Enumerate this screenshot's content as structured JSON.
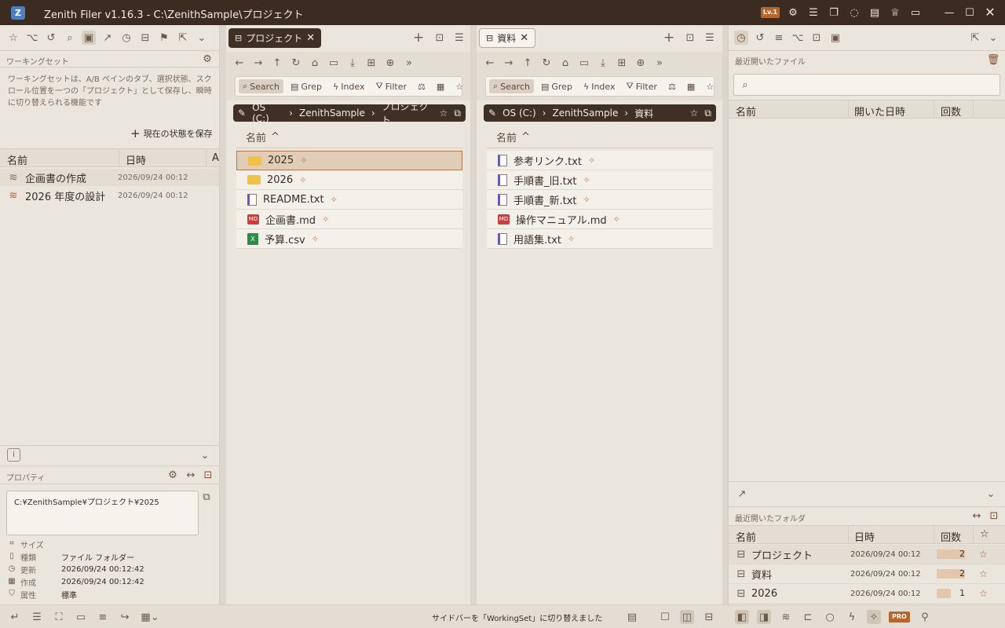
{
  "titlebar": {
    "app_title": "Zenith Filer v1.16.3 - C:\\ZenithSample\\プロジェクト",
    "level_badge": "Lv.1",
    "logo": "Z"
  },
  "left": {
    "workingset_label": "ワーキングセット",
    "workingset_desc": "ワーキングセットは、A/B ペインのタブ、選択状態、スクロール位置を一つの「プロジェクト」として保存し、瞬時に切り替えられる機能です",
    "save_button": "現在の状態を保存",
    "columns": {
      "name": "名前",
      "date": "日時",
      "extra": "A"
    },
    "items": [
      {
        "name": "企画書の作成",
        "date": "2026/09/24 00:12"
      },
      {
        "name": "2026 年度の設計",
        "date": "2026/09/24 00:12"
      }
    ],
    "properties_label": "プロパティ",
    "path_value": "C:¥ZenithSample¥プロジェクト¥2025",
    "props": [
      {
        "label": "サイズ",
        "value": ""
      },
      {
        "label": "種類",
        "value": "ファイル フォルダー"
      },
      {
        "label": "更新",
        "value": "2026/09/24 00:12:42"
      },
      {
        "label": "作成",
        "value": "2026/09/24 00:12:42"
      },
      {
        "label": "属性",
        "value": "標準"
      }
    ]
  },
  "paneA": {
    "tab_label": "プロジェクト",
    "search": {
      "search": "Search",
      "grep": "Grep",
      "index": "Index",
      "filter": "Filter"
    },
    "crumbs": [
      "OS (C:)",
      "ZenithSample",
      "プロジェクト"
    ],
    "col_name": "名前",
    "files": [
      {
        "name": "2025",
        "type": "folder"
      },
      {
        "name": "2026",
        "type": "folder"
      },
      {
        "name": "README.txt",
        "type": "txt"
      },
      {
        "name": "企画書.md",
        "type": "md"
      },
      {
        "name": "予算.csv",
        "type": "csv"
      }
    ]
  },
  "paneB": {
    "tab_label": "資料",
    "search": {
      "search": "Search",
      "grep": "Grep",
      "index": "Index",
      "filter": "Filter"
    },
    "crumbs": [
      "OS (C:)",
      "ZenithSample",
      "資料"
    ],
    "col_name": "名前",
    "files": [
      {
        "name": "参考リンク.txt",
        "type": "txt"
      },
      {
        "name": "手順書_旧.txt",
        "type": "txt"
      },
      {
        "name": "手順書_新.txt",
        "type": "txt"
      },
      {
        "name": "操作マニュアル.md",
        "type": "md"
      },
      {
        "name": "用語集.txt",
        "type": "txt"
      }
    ]
  },
  "right": {
    "recent_files_label": "最近開いたファイル",
    "recent_files_cols": {
      "name": "名前",
      "opened": "開いた日時",
      "count": "回数"
    },
    "recent_folders_label": "最近開いたフォルダ",
    "recent_folders_cols": {
      "name": "名前",
      "date": "日時",
      "count": "回数"
    },
    "folders": [
      {
        "name": "プロジェクト",
        "date": "2026/09/24 00:12",
        "count": "2",
        "fill": 1.0
      },
      {
        "name": "資料",
        "date": "2026/09/24 00:12",
        "count": "2",
        "fill": 1.0
      },
      {
        "name": "2026",
        "date": "2026/09/24 00:12",
        "count": "1",
        "fill": 0.5
      }
    ]
  },
  "status": {
    "message": "サイドバーを「WorkingSet」に切り替えました",
    "pro_badge": "PRO"
  }
}
